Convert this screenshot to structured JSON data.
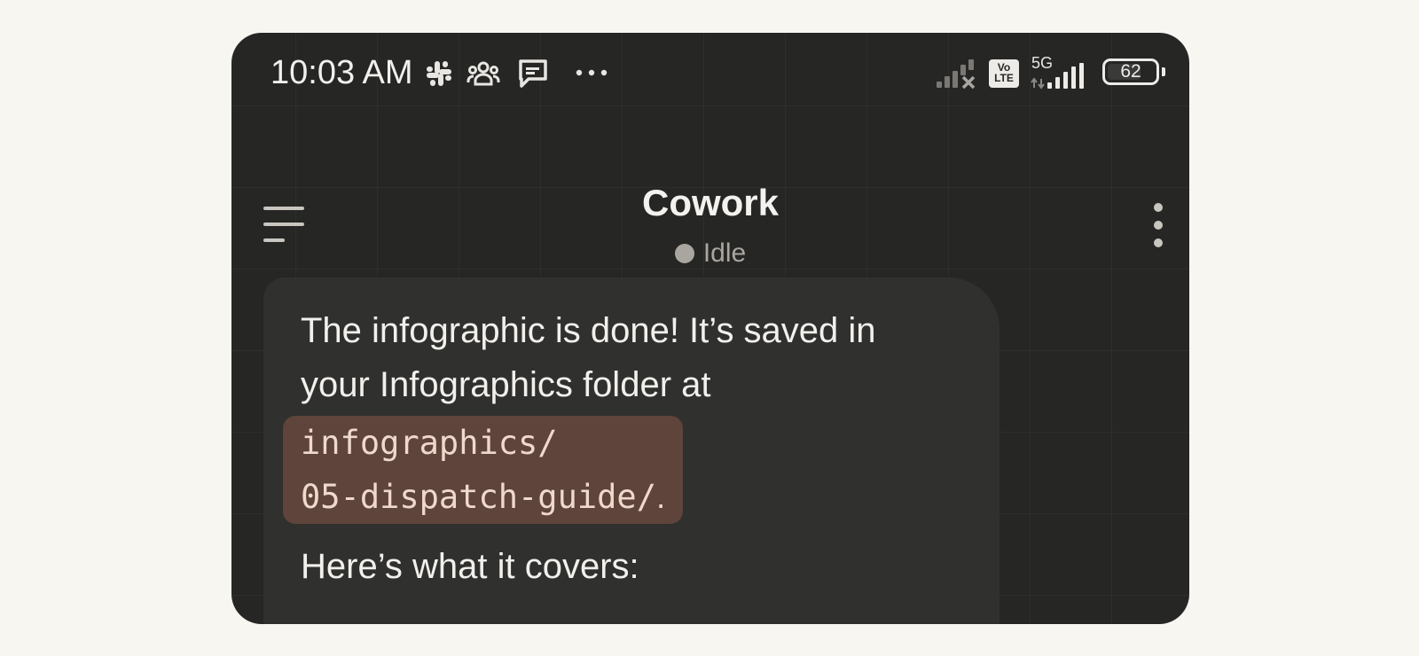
{
  "status_bar": {
    "time": "10:03 AM",
    "network_5g_label": "5G",
    "volte_label_top": "Vo",
    "volte_label_bottom": "LTE",
    "battery_level": "62",
    "icons": [
      "slack-icon",
      "group-icon",
      "chat-icon",
      "more-dots-icon",
      "signal-x-icon",
      "volte-icon",
      "signal-5g-icon",
      "battery-icon"
    ]
  },
  "header": {
    "title": "Cowork",
    "status": "Idle",
    "status_color": "#a9a6a0"
  },
  "message": {
    "line_1": "The infographic is done! It’s saved in",
    "line_2": "your Infographics folder at",
    "code_line_1": "infographics/",
    "code_line_2": "05-dispatch-guide/",
    "code_suffix": ".",
    "covers": "Here’s what it covers:"
  },
  "colors": {
    "background": "#262624",
    "bubble": "#30302e",
    "code_bg": "#5e443a",
    "code_text": "#efd8cc"
  }
}
